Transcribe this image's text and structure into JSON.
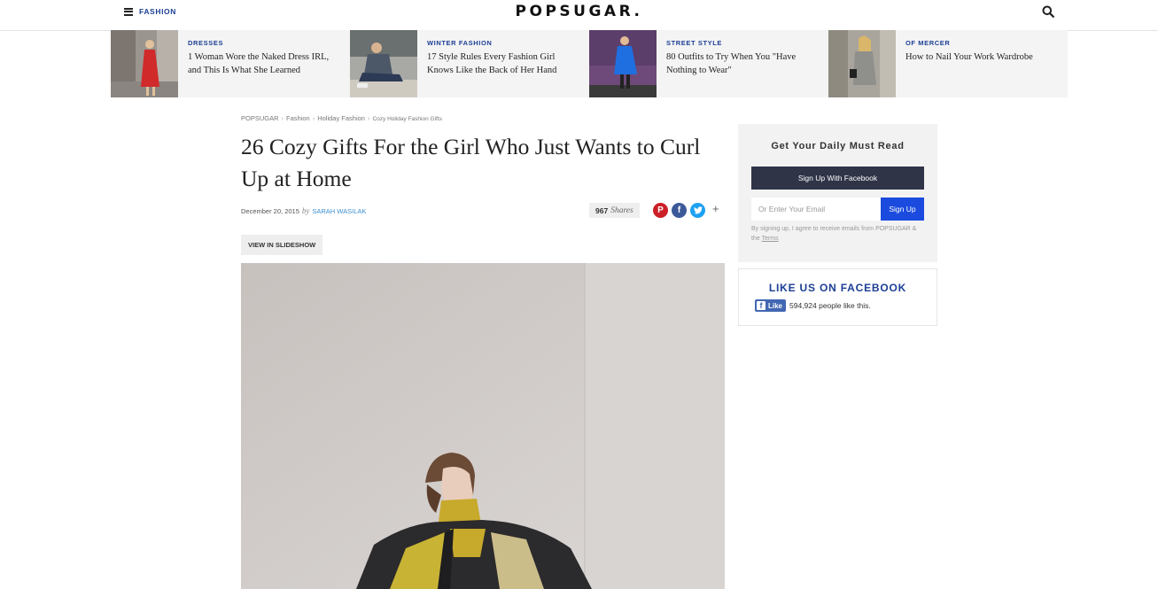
{
  "header": {
    "menu_label": "FASHION",
    "logo": "POPSUGAR."
  },
  "promos": [
    {
      "category": "DRESSES",
      "title": "1 Woman Wore the Naked Dress IRL, and This Is What She Learned"
    },
    {
      "category": "WINTER FASHION",
      "title": "17 Style Rules Every Fashion Girl Knows Like the Back of Her Hand"
    },
    {
      "category": "STREET STYLE",
      "title": "80 Outfits to Try When You \"Have Nothing to Wear\""
    },
    {
      "category": "OF MERCER",
      "title": "How to Nail Your Work Wardrobe"
    }
  ],
  "breadcrumb": [
    "POPSUGAR",
    "Fashion",
    "Holiday Fashion",
    "Cozy Holiday Fashion Gifts"
  ],
  "breadcrumb_sep": "›",
  "article": {
    "title": "26 Cozy Gifts For the Girl Who Just Wants to Curl Up at Home",
    "date": "December 20, 2015",
    "by": "by",
    "author": "SARAH WASILAK",
    "share_count": "967",
    "share_label": "Shares",
    "slideshow_label": "VIEW IN SLIDESHOW"
  },
  "social": {
    "pinterest": "P",
    "facebook": "f",
    "twitter": "t",
    "more": "+"
  },
  "sidebar": {
    "signup_title": "Get Your Daily Must Read",
    "facebook_signup": "Sign Up With Facebook",
    "email_placeholder": "Or Enter Your Email",
    "signup_button": "Sign Up",
    "disclaimer": "By signing up, I agree to receive emails from POPSUGAR & the",
    "terms": "Terms",
    "fb_title": "LIKE US ON FACEBOOK",
    "like_label": "Like",
    "like_count": "594,924 people like this."
  },
  "colors": {
    "brand_blue": "#1c3f94",
    "signup_blue": "#1a4bde",
    "pinterest": "#cb2027",
    "facebook": "#3b5998",
    "twitter": "#1da1f2"
  }
}
